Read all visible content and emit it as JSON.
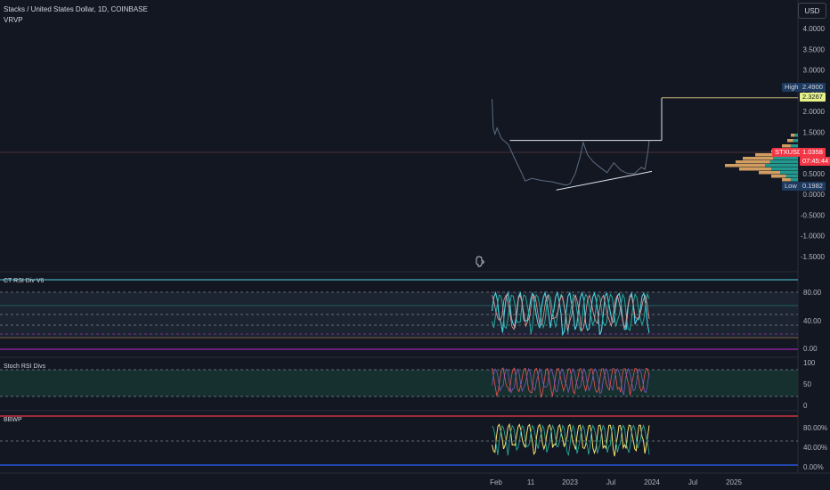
{
  "header": {
    "title": "Stacks / United States Dollar, 1D, COINBASE",
    "indicator": "VRVP",
    "currency_button": "USD"
  },
  "panes": {
    "rsi": {
      "title": "CT RSI Div V6",
      "ticks": [
        "80.00",
        "40.00",
        "0.00"
      ]
    },
    "stoch": {
      "title": "Stoch RSI Divs",
      "ticks": [
        "100",
        "50",
        "0"
      ]
    },
    "bbwp": {
      "title": "BBWP",
      "ticks": [
        "80.00%",
        "40.00%",
        "0.00%"
      ]
    }
  },
  "price_axis": {
    "ticks": [
      "4.0000",
      "3.5000",
      "3.0000",
      "2.5000",
      "2.0000",
      "1.5000",
      "0.5000",
      "0.0000",
      "-0.5000",
      "-1.0000",
      "-1.5000"
    ]
  },
  "tags": {
    "high_label": "High",
    "high_value": "2.4900",
    "target_value": "2.3267",
    "symbol_label": "STXUSD",
    "current_price": "1.0358",
    "countdown": "07:45:44",
    "low_label": "Low",
    "low_value": "0.1982"
  },
  "time_axis": [
    "Feb",
    "11",
    "2023",
    "Jul",
    "2024",
    "Jul",
    "2025"
  ],
  "colors": {
    "background": "#131722",
    "price_line": "#5a6c80",
    "annotation": "#e0e3eb",
    "target_line": "#c9b27a",
    "current_price": "#f23645",
    "target_tag": "#e5f28a",
    "volume_profile_up": "#26a69a",
    "volume_profile_down": "#f5b56b"
  },
  "chart_data": {
    "type": "line",
    "title": "Stacks / United States Dollar, 1D, COINBASE",
    "xlabel": "",
    "ylabel": "",
    "ylim": [
      -1.75,
      4.25
    ],
    "grid": false,
    "x": [
      "2022-01-19",
      "2022-01-24",
      "2022-02-01",
      "2022-02-10",
      "2022-03-01",
      "2022-04-01",
      "2022-05-01",
      "2022-06-01",
      "2022-06-15",
      "2022-07-15",
      "2022-09-01",
      "2022-10-15",
      "2022-11-01",
      "2022-12-15",
      "2023-01-01",
      "2023-01-25",
      "2023-02-15",
      "2023-03-01",
      "2023-03-20",
      "2023-04-15",
      "2023-05-15",
      "2023-06-15",
      "2023-07-15",
      "2023-08-15",
      "2023-09-15",
      "2023-10-15",
      "2023-11-15",
      "2023-12-01",
      "2023-12-15",
      "2023-12-20"
    ],
    "series": [
      {
        "values": [
          2.3,
          1.6,
          1.45,
          1.6,
          1.35,
          1.2,
          0.85,
          0.5,
          0.32,
          0.38,
          0.33,
          0.3,
          0.27,
          0.22,
          0.25,
          0.5,
          0.9,
          1.25,
          0.95,
          0.78,
          0.65,
          0.52,
          0.76,
          0.58,
          0.5,
          0.5,
          0.65,
          0.6,
          1.05,
          1.3
        ]
      }
    ],
    "annotations": {
      "horizontal_level": 1.3,
      "target_level": 2.33,
      "support_line": {
        "from": [
          "2022-11-01",
          0.1
        ],
        "to": [
          "2024-01-01",
          0.55
        ]
      }
    },
    "rsi_levels": [
      80,
      40,
      0
    ],
    "stoch_levels": [
      100,
      50,
      0
    ],
    "bbwp_levels": [
      80,
      40,
      0
    ]
  }
}
